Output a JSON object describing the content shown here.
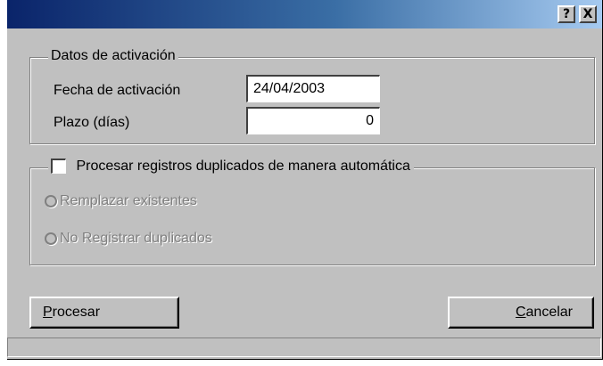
{
  "window": {
    "help_button_label": "?",
    "close_button_label": "X",
    "titlebar_gradient": [
      "#0a246a",
      "#3a6ea5",
      "#a6caf0"
    ]
  },
  "activation_group": {
    "legend": "Datos de activación",
    "date_label": "Fecha de activación",
    "date_value": "24/04/2003",
    "days_label": "Plazo (días)",
    "days_value": "0"
  },
  "duplicates_group": {
    "checkbox_label": "Procesar registros duplicados de manera automática",
    "checkbox_checked": false,
    "options": [
      {
        "label": "Remplazar existentes",
        "enabled": false,
        "selected": false
      },
      {
        "label": "No Registrar duplicados",
        "enabled": false,
        "selected": false
      }
    ]
  },
  "buttons": {
    "process_first_letter": "P",
    "process_rest": "rocesar",
    "cancel_first_letter": "C",
    "cancel_rest": "ancelar"
  },
  "colors": {
    "face": "#c0c0c0",
    "disabled_text": "#808080"
  }
}
